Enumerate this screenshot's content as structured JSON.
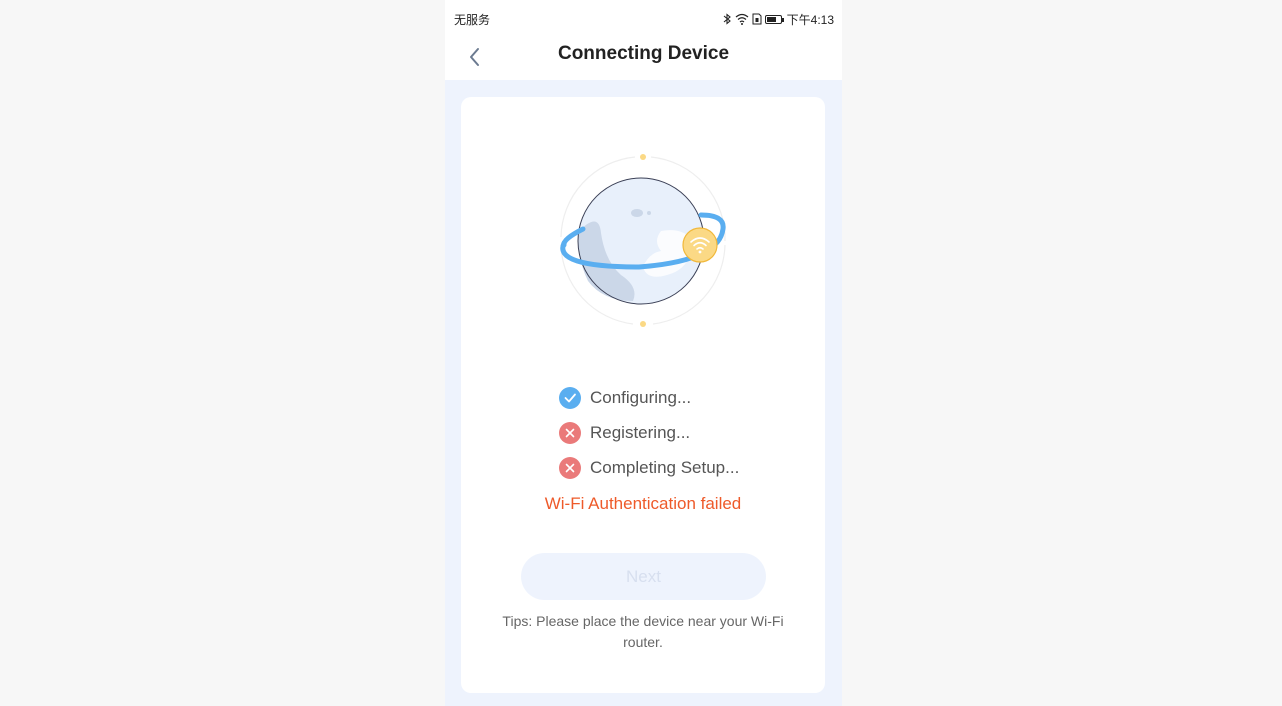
{
  "status_bar": {
    "carrier": "无服务",
    "time": "下午4:13",
    "icons": [
      "bluetooth-icon",
      "wifi-icon",
      "sim-icon",
      "battery-icon"
    ]
  },
  "nav": {
    "title": "Connecting Device",
    "back_icon": "chevron-left-icon"
  },
  "steps": [
    {
      "label": "Configuring...",
      "state": "done",
      "icon": "check-circle-icon"
    },
    {
      "label": "Registering...",
      "state": "failed",
      "icon": "x-circle-icon"
    },
    {
      "label": "Completing Setup...",
      "state": "failed",
      "icon": "x-circle-icon"
    }
  ],
  "error": "Wi-Fi Authentication failed",
  "next_button": "Next",
  "tips": "Tips: Please place the device near your Wi-Fi router.",
  "colors": {
    "accent": "#5aaef0",
    "fail": "#ea7a7a",
    "error_text": "#ee5a2a",
    "page_bg": "#eef3fd"
  }
}
